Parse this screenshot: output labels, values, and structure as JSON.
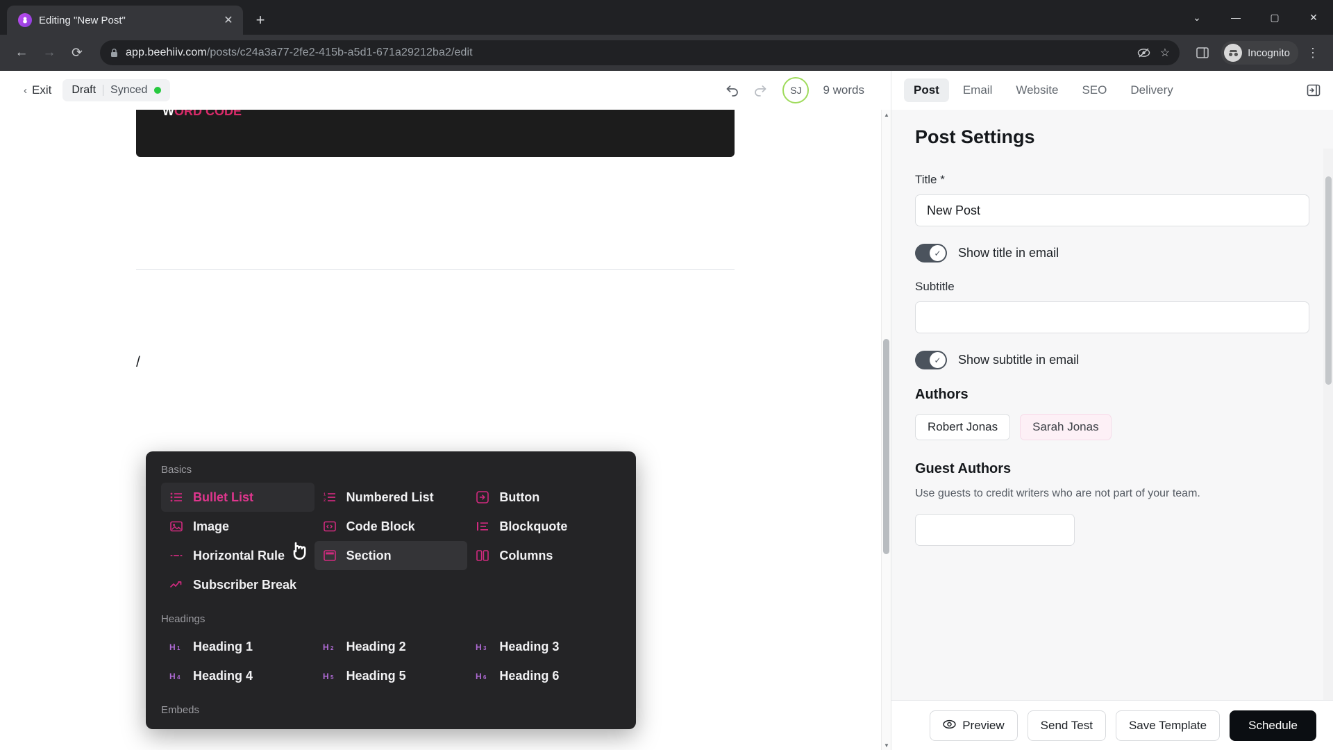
{
  "browser": {
    "tab": {
      "title": "Editing \"New Post\"",
      "favicon": "beehiiv-logo-icon",
      "close": "✕"
    },
    "new_tab": "+",
    "window_controls": {
      "minimize_chevron": "⌄",
      "minimize": "—",
      "maximize": "▢",
      "close": "✕"
    },
    "nav": {
      "back": "←",
      "forward": "→",
      "reload": "⟳"
    },
    "omnibox": {
      "lock": "🔒",
      "url_domain": "app.beehiiv.com",
      "url_path": "/posts/c24a3a77-2fe2-415b-a5d1-671a29212ba2/edit",
      "tracking_protection": "◎",
      "bookmark": "☆",
      "side_panel": "▣"
    },
    "profile": {
      "label": "Incognito",
      "avatar": "🕶"
    },
    "menu": "⋮"
  },
  "editor": {
    "exit_label": "Exit",
    "exit_chevron": "‹",
    "status": {
      "draft": "Draft",
      "divider": "|",
      "synced": "Synced",
      "dot_color": "#27c93f"
    },
    "undo": "↺",
    "redo": "↻",
    "avatar_initials": "SJ",
    "avatar_ring_color": "#9fdb5c",
    "word_count": "9 words",
    "document": {
      "dark_block_text": "WORD CODE",
      "slash_trigger": "/"
    }
  },
  "slash_menu": {
    "groups": [
      {
        "name": "Basics",
        "items": [
          {
            "label": "Bullet List",
            "icon": "bullet-list-icon",
            "glyph": "☰",
            "state": "selected"
          },
          {
            "label": "Numbered List",
            "icon": "numbered-list-icon",
            "glyph": "≣",
            "state": "normal"
          },
          {
            "label": "Button",
            "icon": "button-icon",
            "glyph": "▣",
            "state": "normal"
          },
          {
            "label": "Image",
            "icon": "image-icon",
            "glyph": "▤",
            "state": "normal"
          },
          {
            "label": "Code Block",
            "icon": "code-block-icon",
            "glyph": "▥",
            "state": "normal"
          },
          {
            "label": "Blockquote",
            "icon": "blockquote-icon",
            "glyph": "❝",
            "state": "normal"
          },
          {
            "label": "Horizontal Rule",
            "icon": "horizontal-rule-icon",
            "glyph": "—",
            "state": "normal"
          },
          {
            "label": "Section",
            "icon": "section-icon",
            "glyph": "▦",
            "state": "hovered"
          },
          {
            "label": "Columns",
            "icon": "columns-icon",
            "glyph": "◫",
            "state": "normal"
          },
          {
            "label": "Subscriber Break",
            "icon": "subscriber-break-icon",
            "glyph": "↯",
            "state": "normal"
          }
        ]
      },
      {
        "name": "Headings",
        "items": [
          {
            "label": "Heading 1",
            "icon": "heading-1-icon",
            "glyph": "H₁",
            "state": "normal"
          },
          {
            "label": "Heading 2",
            "icon": "heading-2-icon",
            "glyph": "H₂",
            "state": "normal"
          },
          {
            "label": "Heading 3",
            "icon": "heading-3-icon",
            "glyph": "H₃",
            "state": "normal"
          },
          {
            "label": "Heading 4",
            "icon": "heading-4-icon",
            "glyph": "H₄",
            "state": "normal"
          },
          {
            "label": "Heading 5",
            "icon": "heading-5-icon",
            "glyph": "H₅",
            "state": "normal"
          },
          {
            "label": "Heading 6",
            "icon": "heading-6-icon",
            "glyph": "H₆",
            "state": "normal"
          }
        ]
      },
      {
        "name": "Embeds",
        "items": []
      }
    ],
    "accent_color": "#d12a7f",
    "selected_text_color": "#e0368e"
  },
  "panel": {
    "tabs": [
      {
        "label": "Post",
        "active": true
      },
      {
        "label": "Email",
        "active": false
      },
      {
        "label": "Website",
        "active": false
      },
      {
        "label": "SEO",
        "active": false
      },
      {
        "label": "Delivery",
        "active": false
      }
    ],
    "collapse_icon": "⇥",
    "heading": "Post Settings",
    "title_field": {
      "label": "Title *",
      "value": "New Post",
      "placeholder": ""
    },
    "show_title_toggle": {
      "label": "Show title in email",
      "on": true
    },
    "subtitle_field": {
      "label": "Subtitle",
      "value": "",
      "placeholder": ""
    },
    "show_subtitle_toggle": {
      "label": "Show subtitle in email",
      "on": true
    },
    "authors": {
      "heading": "Authors",
      "chips": [
        {
          "name": "Robert Jonas",
          "style": "plain"
        },
        {
          "name": "Sarah Jonas",
          "style": "pink"
        }
      ]
    },
    "guest_authors": {
      "heading": "Guest Authors",
      "description": "Use guests to credit writers who are not part of your team."
    },
    "actions": {
      "preview": "Preview",
      "preview_icon": "eye-icon",
      "send_test": "Send Test",
      "save_template": "Save Template",
      "schedule": "Schedule"
    }
  }
}
